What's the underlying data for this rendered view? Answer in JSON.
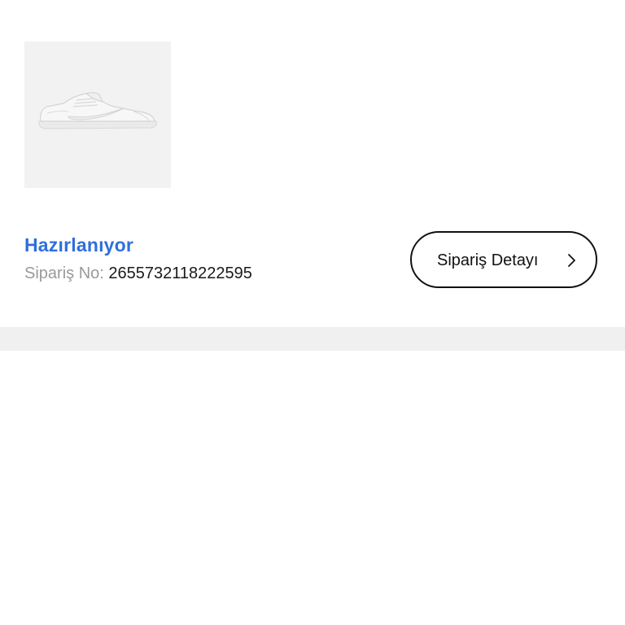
{
  "order": {
    "status": "Hazırlanıyor",
    "order_no_label": "Sipariş No:",
    "order_no_value": "2655732118222595",
    "detail_button_label": "Sipariş Detayı",
    "detail_button_icon": "chevron-right-icon",
    "product_image": "white-sneaker-image"
  },
  "colors": {
    "status": "#2f6fdb",
    "muted": "#9a9a9a",
    "text": "#1a1a1a",
    "thumb_bg": "#f2f2f2",
    "band": "#f0f0f0"
  }
}
